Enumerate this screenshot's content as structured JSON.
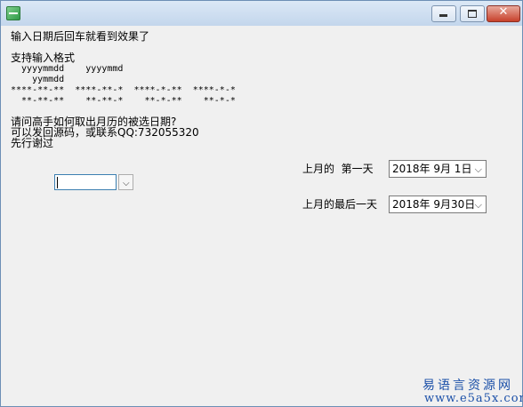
{
  "window": {
    "title": ""
  },
  "text": {
    "line1": "输入日期后回车就看到效果了",
    "formats_heading": "支持输入格式",
    "format_row1": "  yyyymmdd    yyyymmd",
    "format_row2": "    yymmdd",
    "format_row3": "****-**-**  ****-**-*  ****-*-**  ****-*-*",
    "format_row4": "  **-**-**    **-**-*    **-*-**    **-*-*",
    "question": "请问高手如何取出月历的被选日期?",
    "contact": "可以发回源码，或联系QQ:732055320",
    "thanks": "先行谢过"
  },
  "combo": {
    "value": ""
  },
  "first_day": {
    "label": "上月的  第一天",
    "date": "2018年 9月 1日"
  },
  "last_day": {
    "label": "上月的最后一天",
    "date": "2018年 9月30日"
  },
  "watermark": {
    "line1": "易语言资源网",
    "line2": "www.e5a5x.com"
  },
  "icons": [
    "app-icon",
    "minimize-icon",
    "maximize-icon",
    "close-icon",
    "chevron-down-icon"
  ]
}
